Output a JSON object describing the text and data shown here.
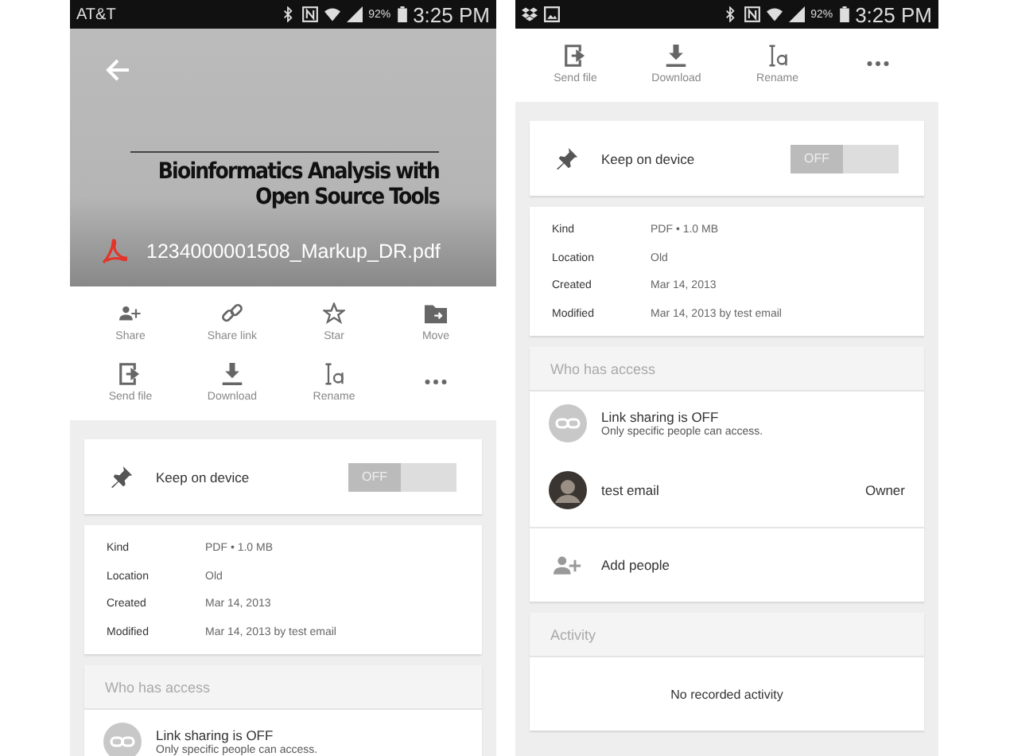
{
  "phones": [
    {
      "status_bar": {
        "carrier": "AT&T",
        "battery": "92%",
        "time": "3:25 PM"
      },
      "header": {
        "document_title": "Bioinformatics Analysis with Open Source Tools",
        "file_name": "1234000001508_Markup_DR.pdf"
      },
      "actions": [
        {
          "kind": "share",
          "label": "Share"
        },
        {
          "kind": "link",
          "label": "Share link"
        },
        {
          "kind": "star",
          "label": "Star"
        },
        {
          "kind": "move",
          "label": "Move"
        },
        {
          "kind": "send",
          "label": "Send file"
        },
        {
          "kind": "download",
          "label": "Download"
        },
        {
          "kind": "rename",
          "label": "Rename"
        },
        {
          "kind": "more"
        }
      ],
      "keep_on_device": {
        "label": "Keep on device",
        "toggle_text": "OFF",
        "on": false
      },
      "details": [
        {
          "label": "Kind",
          "value": "PDF • 1.0 MB"
        },
        {
          "label": "Location",
          "value": "Old"
        },
        {
          "label": "Created",
          "value": "Mar 14, 2013"
        },
        {
          "label": "Modified",
          "value": "Mar 14, 2013 by test email"
        }
      ],
      "access": {
        "title": "Who has access",
        "items": [
          {
            "kind": "link",
            "title": "Link sharing is OFF",
            "subtitle": "Only specific people can access."
          }
        ]
      }
    },
    {
      "status_bar": {
        "notification_icons": [
          {
            "kind": "dropbox"
          },
          {
            "kind": "picture"
          }
        ],
        "battery": "92%",
        "time": "3:25 PM"
      },
      "actions": [
        {
          "kind": "send",
          "label": "Send file"
        },
        {
          "kind": "download",
          "label": "Download"
        },
        {
          "kind": "rename",
          "label": "Rename"
        },
        {
          "kind": "more"
        }
      ],
      "keep_on_device": {
        "label": "Keep on device",
        "toggle_text": "OFF",
        "on": false
      },
      "details": [
        {
          "label": "Kind",
          "value": "PDF • 1.0 MB"
        },
        {
          "label": "Location",
          "value": "Old"
        },
        {
          "label": "Created",
          "value": "Mar 14, 2013"
        },
        {
          "label": "Modified",
          "value": "Mar 14, 2013 by test email"
        }
      ],
      "access": {
        "title": "Who has access",
        "items": [
          {
            "kind": "link",
            "title": "Link sharing is OFF",
            "subtitle": "Only specific people can access."
          },
          {
            "kind": "person",
            "name": "test email",
            "role": "Owner"
          },
          {
            "kind": "add",
            "label": "Add people"
          }
        ]
      },
      "activity": {
        "title": "Activity",
        "message": "No recorded activity"
      }
    }
  ]
}
